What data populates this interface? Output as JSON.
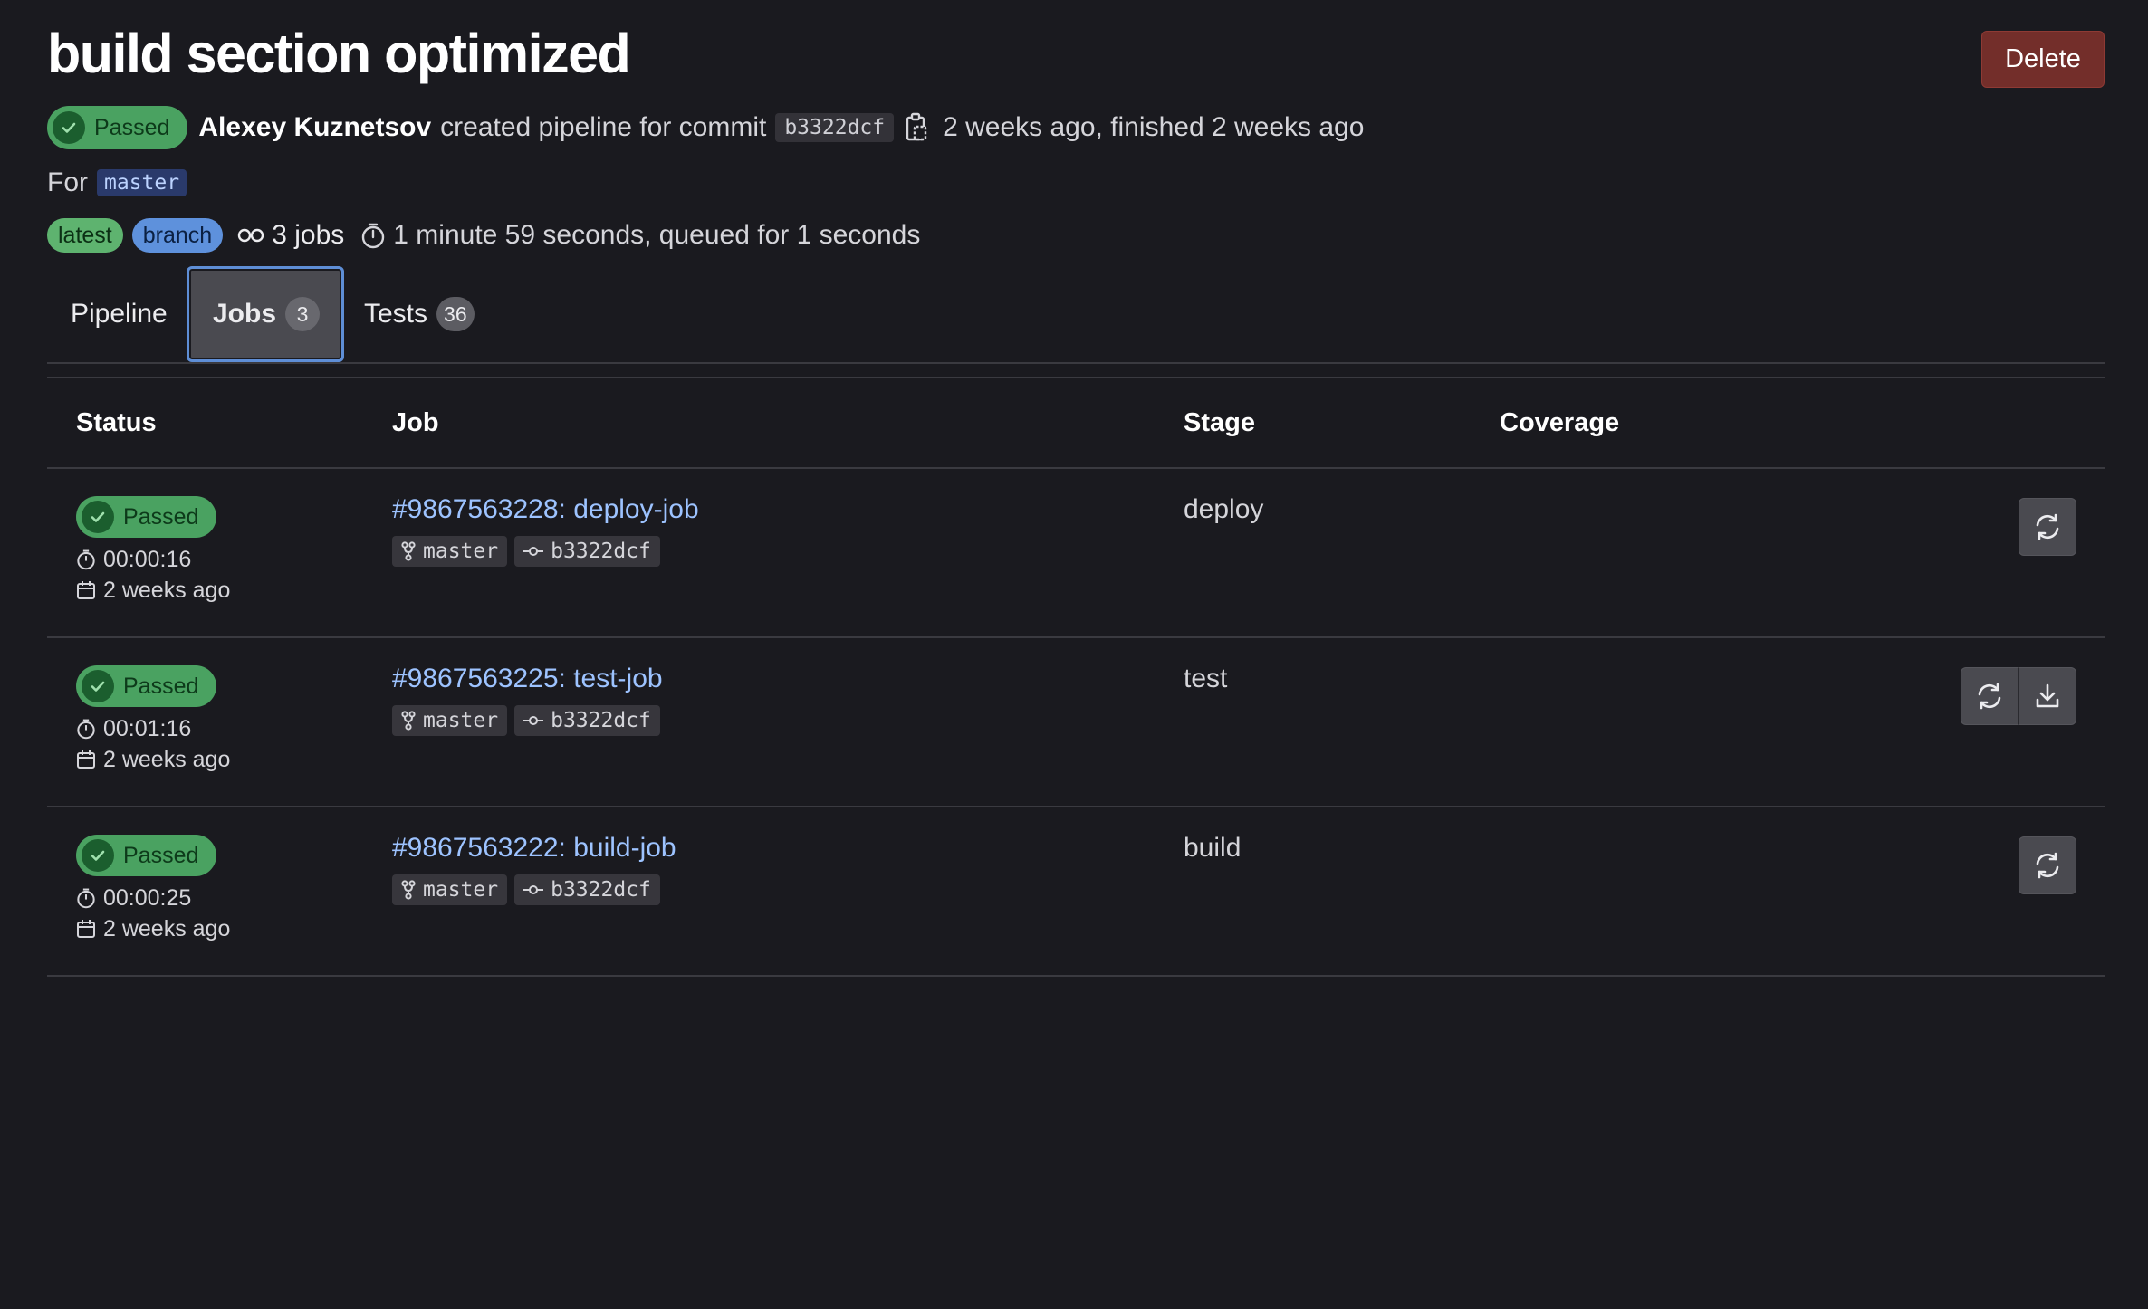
{
  "header": {
    "title": "build section optimized",
    "delete_label": "Delete",
    "status": "Passed",
    "author": "Alexey Kuznetsov",
    "action_text": "created pipeline for commit",
    "commit_sha": "b3322dcf",
    "time_text": "2 weeks ago, finished 2 weeks ago",
    "for_label": "For",
    "branch": "master",
    "badges": [
      "latest",
      "branch"
    ],
    "jobs_text": "3 jobs",
    "duration_text": "1 minute 59 seconds, queued for 1 seconds"
  },
  "tabs": [
    {
      "label": "Pipeline"
    },
    {
      "label": "Jobs",
      "count": "3",
      "active": true
    },
    {
      "label": "Tests",
      "count": "36"
    }
  ],
  "table": {
    "columns": [
      "Status",
      "Job",
      "Stage",
      "Coverage"
    ],
    "rows": [
      {
        "status": "Passed",
        "duration": "00:00:16",
        "finished": "2 weeks ago",
        "job": "#9867563228: deploy-job",
        "branch": "master",
        "sha": "b3322dcf",
        "stage": "deploy",
        "actions": [
          "retry-icon"
        ]
      },
      {
        "status": "Passed",
        "duration": "00:01:16",
        "finished": "2 weeks ago",
        "job": "#9867563225: test-job",
        "branch": "master",
        "sha": "b3322dcf",
        "stage": "test",
        "actions": [
          "retry-icon",
          "download-icon"
        ]
      },
      {
        "status": "Passed",
        "duration": "00:00:25",
        "finished": "2 weeks ago",
        "job": "#9867563222: build-job",
        "branch": "master",
        "sha": "b3322dcf",
        "stage": "build",
        "actions": [
          "retry-icon"
        ]
      }
    ]
  },
  "colors": {
    "background": "#1a1a1f",
    "success": "#4aa261",
    "link": "#9dc3ff",
    "danger": "#732e2a",
    "focus": "#5e8ed6"
  }
}
